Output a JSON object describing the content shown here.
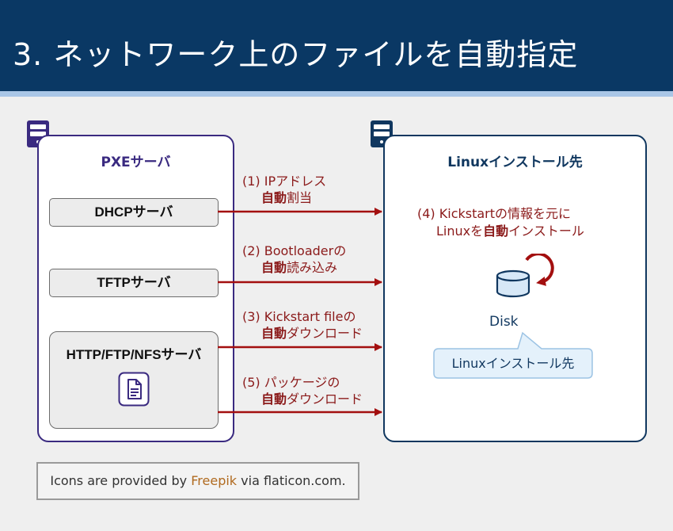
{
  "header": {
    "title": "3. ネットワーク上のファイルを自動指定"
  },
  "pxe_panel": {
    "title": "PXEサーバ",
    "servers": [
      {
        "label": "DHCPサーバ"
      },
      {
        "label": "TFTPサーバ"
      },
      {
        "label": "HTTP/FTP/NFSサーバ"
      }
    ]
  },
  "linux_panel": {
    "title": "Linuxインストール先",
    "step4": {
      "line1": "(4) Kickstartの情報を元に",
      "line2_pre": "Linuxを",
      "line2_bold": "自動",
      "line2_post": "インストール"
    },
    "disk_label": "Disk",
    "callout": "Linuxインストール先"
  },
  "arrows": [
    {
      "line1": "(1) IPアドレス",
      "bold": "自動",
      "rest": "割当"
    },
    {
      "line1": "(2) Bootloaderの",
      "bold": "自動",
      "rest": "読み込み"
    },
    {
      "line1": "(3) Kickstart fileの",
      "bold": "自動",
      "rest": "ダウンロード"
    },
    {
      "line1": "(5) パッケージの",
      "bold": "自動",
      "rest": "ダウンロード"
    }
  ],
  "credit": {
    "pre": "Icons are provided by ",
    "accent": "Freepik",
    "post": " via flaticon.com."
  },
  "colors": {
    "header": "#0a3864",
    "arrow": "#a30f0f",
    "pxe": "#3a2a80",
    "linux": "#10375f",
    "accent": "#b06a1f"
  },
  "icons": [
    "server-icon",
    "server-icon",
    "document-icon",
    "disk-icon",
    "rotate-arrow-icon"
  ]
}
